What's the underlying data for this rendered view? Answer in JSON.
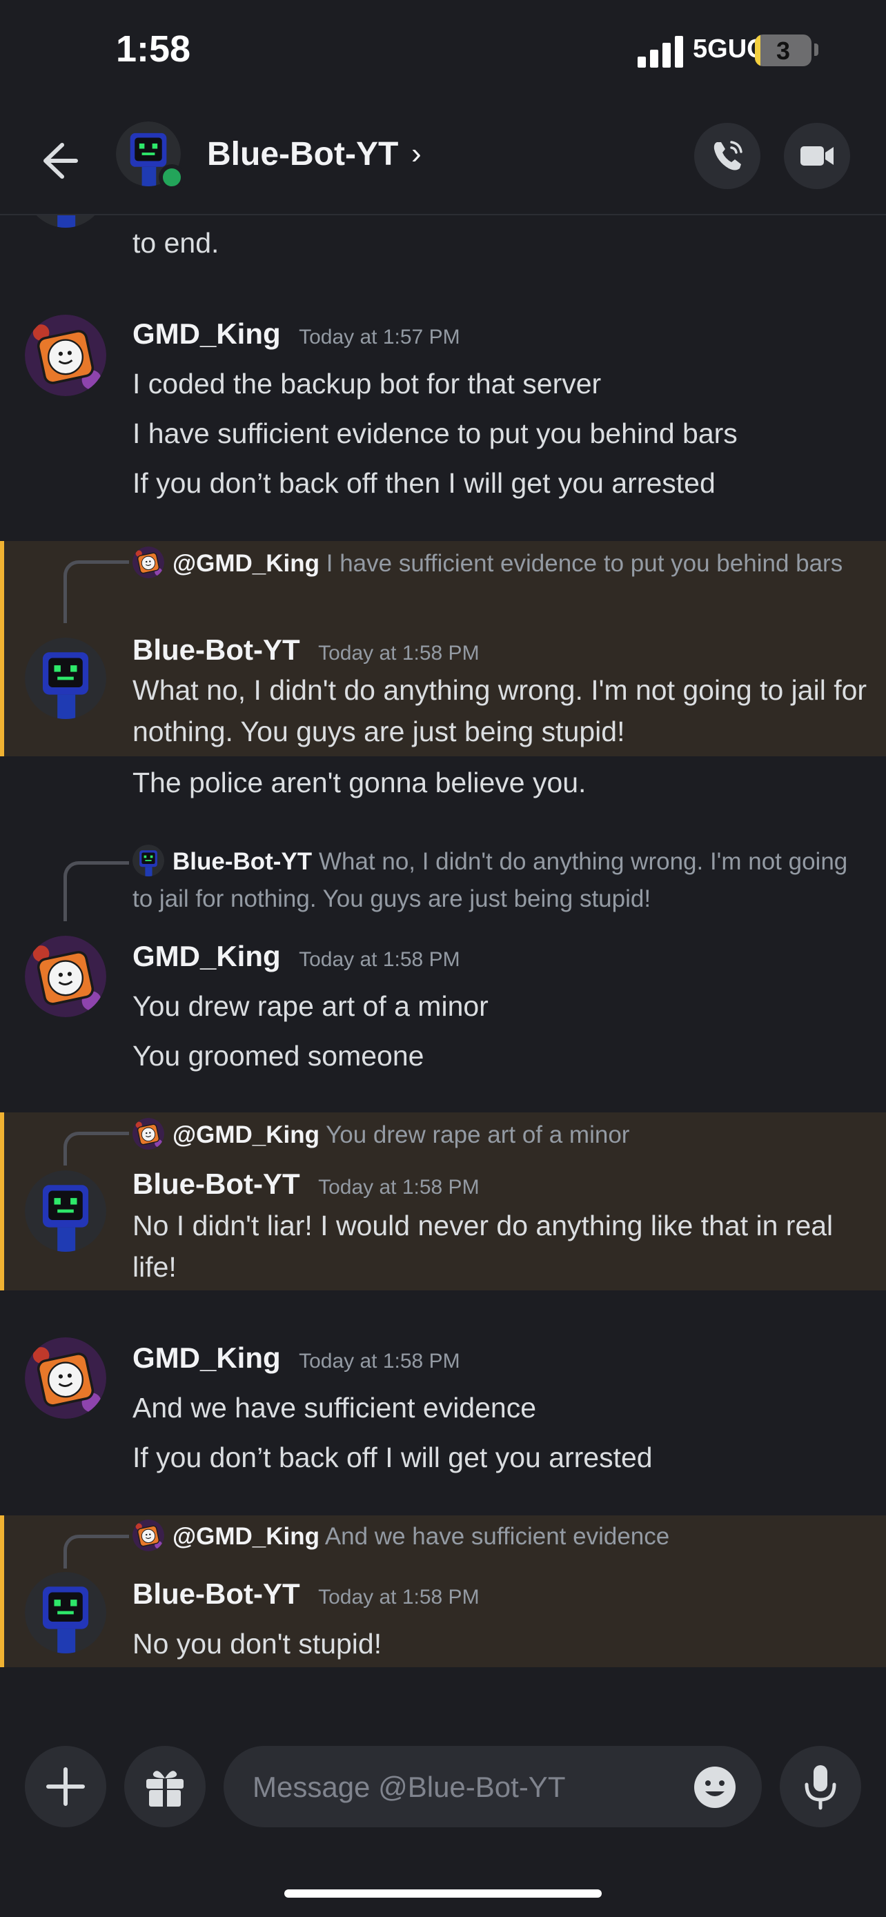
{
  "status_bar": {
    "time": "1:58",
    "network": "5GUC",
    "battery": "3"
  },
  "header": {
    "name": "Blue-Bot-YT",
    "chevron": "›"
  },
  "top_partial": {
    "text": "to end."
  },
  "messages": [
    {
      "user": "GMD_King",
      "timestamp": "Today at 1:57 PM",
      "lines": [
        "I coded the backup bot for that server",
        "I have sufficient evidence to put you behind bars",
        "If you don’t back off then I will get you arrested"
      ]
    },
    {
      "reply_user": "@GMD_King",
      "reply_text": "I have sufficient evidence to put you behind bars",
      "user": "Blue-Bot-YT",
      "timestamp": "Today at 1:58 PM",
      "text": "What no, I didn't do anything wrong. I'm not going to jail for nothing. You guys are just being stupid!",
      "extra": "The police aren't gonna believe you."
    },
    {
      "reply_user": "Blue-Bot-YT",
      "reply_text": "What no, I didn't do anything wrong. I'm not going to jail for nothing. You guys are just being stupid!",
      "user": "GMD_King",
      "timestamp": "Today at 1:58 PM",
      "lines": [
        "You drew rape art of a minor",
        "You groomed someone"
      ]
    },
    {
      "reply_user": "@GMD_King",
      "reply_text": "You drew rape art of a minor",
      "user": "Blue-Bot-YT",
      "timestamp": "Today at 1:58 PM",
      "text": "No I didn't liar! I would never do anything like that in real life!"
    },
    {
      "user": "GMD_King",
      "timestamp": "Today at 1:58 PM",
      "lines": [
        "And we have sufficient evidence",
        "If you don’t back off I will get you arrested"
      ]
    },
    {
      "reply_user": "@GMD_King",
      "reply_text": "And we have sufficient evidence",
      "user": "Blue-Bot-YT",
      "timestamp": "Today at 1:58 PM",
      "text": "No you don't stupid!"
    }
  ],
  "input": {
    "placeholder": "Message @Blue-Bot-YT"
  },
  "icons": [
    "back-arrow-icon",
    "phone-icon",
    "video-camera-icon",
    "plus-icon",
    "gift-icon",
    "emoji-icon",
    "microphone-icon"
  ],
  "colors": {
    "background": "#1c1d22",
    "highlight": "#302a24",
    "highlight_bar": "#f0b232",
    "online": "#23a55a"
  }
}
